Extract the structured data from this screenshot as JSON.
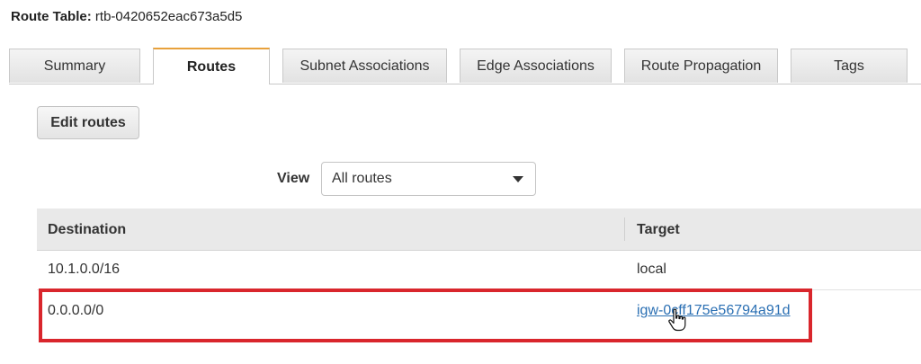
{
  "header": {
    "label": "Route Table:",
    "route_table_id": "rtb-0420652eac673a5d5"
  },
  "tabs": [
    {
      "label": "Summary",
      "active": false
    },
    {
      "label": "Routes",
      "active": true
    },
    {
      "label": "Subnet Associations",
      "active": false
    },
    {
      "label": "Edge Associations",
      "active": false
    },
    {
      "label": "Route Propagation",
      "active": false
    },
    {
      "label": "Tags",
      "active": false
    }
  ],
  "toolbar": {
    "edit_routes_label": "Edit routes"
  },
  "view_filter": {
    "label": "View",
    "selected": "All routes"
  },
  "table": {
    "columns": [
      "Destination",
      "Target"
    ],
    "rows": [
      {
        "destination": "10.1.0.0/16",
        "target": "local",
        "target_is_link": false
      },
      {
        "destination": "0.0.0.0/0",
        "target": "igw-0cff175e56794a91d",
        "target_is_link": true,
        "highlighted": true
      }
    ]
  },
  "colors": {
    "active_tab_accent": "#e8a13b",
    "highlight_border": "#d9262c",
    "link": "#2a6fb3"
  },
  "icons": {
    "dropdown": "caret-down-icon",
    "pointer": "hand-pointer-icon"
  }
}
